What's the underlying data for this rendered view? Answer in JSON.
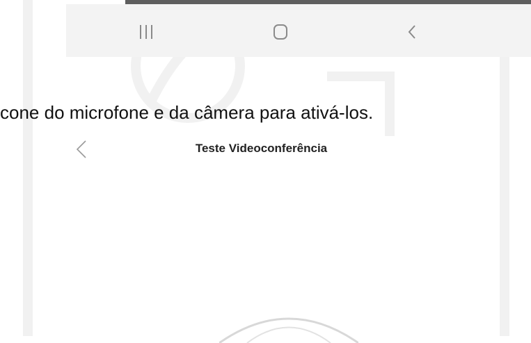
{
  "instruction": {
    "text": "cone do microfone e da câmera para ativá-los."
  },
  "phone_nav": {
    "recents_icon": "recent-apps-icon",
    "home_icon": "home-icon",
    "back_icon": "back-icon"
  },
  "app": {
    "title": "Teste Videoconferência",
    "back_icon": "back-chevron-icon",
    "camera_control_icon": "circular-control-icon"
  },
  "colors": {
    "nav_background": "#f3f3f3",
    "nav_strip": "#5e5e5e",
    "text": "#111111"
  }
}
